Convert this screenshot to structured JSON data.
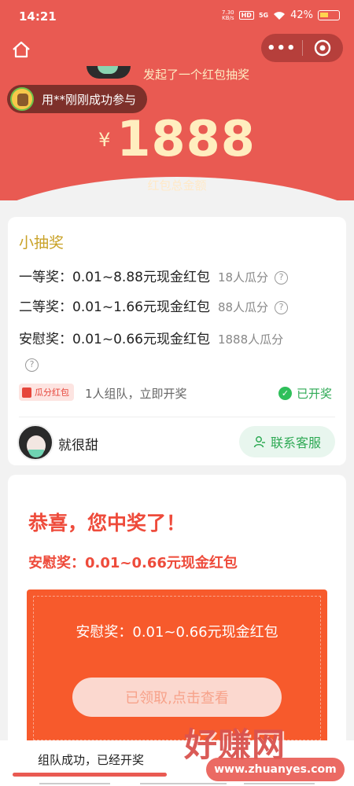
{
  "status_bar": {
    "time": "14:21",
    "net_speed_value": "7.30",
    "net_speed_unit": "KB/s",
    "hd": "HD",
    "signal": "5G",
    "battery": "42%"
  },
  "header": {
    "initiator_text": "发起了一个红包抽奖",
    "join_toast": "用**刚刚成功参与",
    "currency": "¥",
    "amount": "1888",
    "amount_caption": "红包总金额",
    "more_icon": "more-dots-icon",
    "target_icon": "target-icon",
    "home_icon": "home-icon"
  },
  "lottery": {
    "title": "小抽奖",
    "prizes": [
      {
        "name": "一等奖：0.01~8.88元现金红包",
        "count": "18人瓜分"
      },
      {
        "name": "二等奖：0.01~1.66元现金红包",
        "count": "88人瓜分"
      },
      {
        "name": "安慰奖：0.01~0.66元现金红包",
        "count": "1888人瓜分"
      }
    ],
    "tag": "瓜分红包",
    "team_text": "1人组队，立即开奖",
    "status": "已开奖",
    "host_name": "就很甜",
    "service_button": "联系客服"
  },
  "win": {
    "title": "恭喜，您中奖了！",
    "prize": "安慰奖：0.01~0.66元现金红包",
    "box_text": "安慰奖：0.01~0.66元现金红包",
    "claim_button": "已领取,点击查看"
  },
  "bottom": {
    "status_text": "组队成功，已经开奖",
    "progress": 1.0
  },
  "watermark": {
    "text": "好赚网",
    "url": "www.zhuanyes.com"
  },
  "colors": {
    "brand_red": "#e95a52",
    "gold": "#c9a227",
    "success_green": "#2faa55",
    "prize_orange": "#f75a2c"
  }
}
